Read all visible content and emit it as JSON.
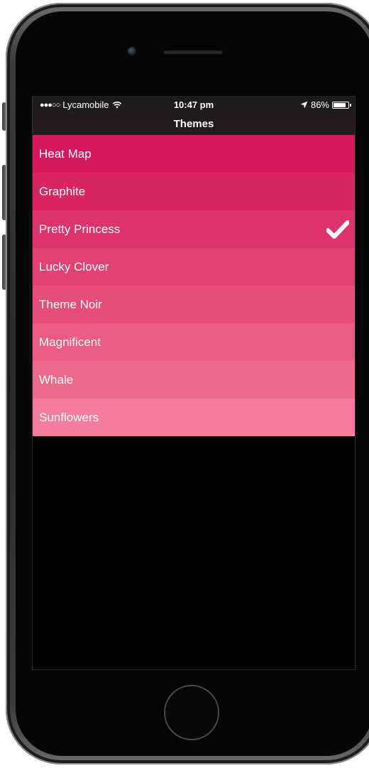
{
  "status_bar": {
    "signal": "●●●○○",
    "carrier": "Lycamobile",
    "wifi_icon": "wifi-icon",
    "time": "10:47 pm",
    "location_icon": "location-arrow-icon",
    "battery_percent": "86%",
    "battery_level": 0.86
  },
  "nav": {
    "title": "Themes"
  },
  "themes": [
    {
      "label": "Heat Map",
      "color": "#D6185D",
      "selected": false
    },
    {
      "label": "Graphite",
      "color": "#DA2563",
      "selected": false
    },
    {
      "label": "Pretty Princess",
      "color": "#DE336A",
      "selected": true
    },
    {
      "label": "Lucky Clover",
      "color": "#E24172",
      "selected": false
    },
    {
      "label": "Theme Noir",
      "color": "#E64E79",
      "selected": false
    },
    {
      "label": "Magnificent",
      "color": "#EA5C81",
      "selected": false
    },
    {
      "label": "Whale",
      "color": "#EE6A89",
      "selected": false
    },
    {
      "label": "Sunflowers",
      "color": "#F57C9A",
      "selected": false
    }
  ],
  "colors": {
    "nav_background": "#1b1b1b",
    "screen_background": "#000000",
    "text": "#FFFFFF"
  }
}
